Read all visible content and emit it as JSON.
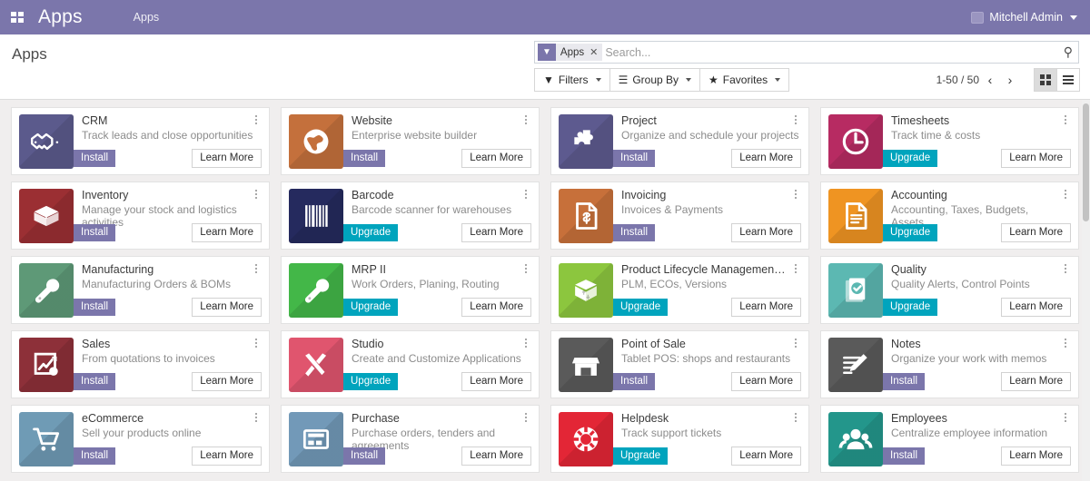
{
  "navbar": {
    "apps_grid_icon": "grid-icon",
    "brand": "Apps",
    "menu_item": "Apps",
    "user_name": "Mitchell Admin",
    "avatar_icon": "avatar-icon",
    "caret_icon": "chevron-down-icon",
    "bg_color": "#7b76ab"
  },
  "control_panel": {
    "title": "Apps",
    "search": {
      "facet_label": "Apps",
      "facet_icon": "filter-icon",
      "facet_remove_icon": "close-icon",
      "placeholder": "Search...",
      "value": "",
      "search_icon": "search-icon"
    },
    "filters_label": "Filters",
    "filters_icon": "filter-icon",
    "groupby_label": "Group By",
    "groupby_icon": "list-icon",
    "favorites_label": "Favorites",
    "favorites_icon": "star-icon",
    "pager_text": "1-50 / 50",
    "pager_prev_icon": "chevron-left-icon",
    "pager_next_icon": "chevron-right-icon",
    "view_kanban_icon": "kanban-view-icon",
    "view_list_icon": "list-view-icon",
    "active_view": "kanban"
  },
  "labels": {
    "install": "Install",
    "upgrade": "Upgrade",
    "learn_more": "Learn More",
    "kebab_icon": "kebab-menu-icon"
  },
  "colors": {
    "install_button": "#7b76ab",
    "upgrade_button": "#00a4bd",
    "navbar": "#7b76ab"
  },
  "apps": [
    {
      "name": "CRM",
      "desc": "Track leads and close opportunities",
      "action": "Install",
      "icon": "handshake-icon",
      "color": "#5b5a8c"
    },
    {
      "name": "Website",
      "desc": "Enterprise website builder",
      "action": "Install",
      "icon": "globe-icon",
      "color": "#c4703c"
    },
    {
      "name": "Project",
      "desc": "Organize and schedule your projects",
      "action": "Install",
      "icon": "puzzle-icon",
      "color": "#5d5a8f"
    },
    {
      "name": "Timesheets",
      "desc": "Track time & costs",
      "action": "Upgrade",
      "icon": "clock-icon",
      "color": "#b72b62"
    },
    {
      "name": "Inventory",
      "desc": "Manage your stock and logistics activities",
      "action": "Install",
      "icon": "box-icon",
      "color": "#9b2f33"
    },
    {
      "name": "Barcode",
      "desc": "Barcode scanner for warehouses",
      "action": "Upgrade",
      "icon": "barcode-icon",
      "color": "#252a5e"
    },
    {
      "name": "Invoicing",
      "desc": "Invoices & Payments",
      "action": "Install",
      "icon": "invoice-icon",
      "color": "#c7703a"
    },
    {
      "name": "Accounting",
      "desc": "Accounting, Taxes, Budgets, Assets...",
      "action": "Upgrade",
      "icon": "document-icon",
      "color": "#ef9422"
    },
    {
      "name": "Manufacturing",
      "desc": "Manufacturing Orders & BOMs",
      "action": "Install",
      "icon": "wrench-icon",
      "color": "#5e9977"
    },
    {
      "name": "MRP II",
      "desc": "Work Orders, Planing, Routing",
      "action": "Upgrade",
      "icon": "wrench-icon",
      "color": "#43b748"
    },
    {
      "name": "Product Lifecycle Management (...",
      "desc": "PLM, ECOs, Versions",
      "action": "Upgrade",
      "icon": "box-arrows-icon",
      "color": "#8cc63e"
    },
    {
      "name": "Quality",
      "desc": "Quality Alerts, Control Points",
      "action": "Upgrade",
      "icon": "clipboard-check-icon",
      "color": "#5cb8b2"
    },
    {
      "name": "Sales",
      "desc": "From quotations to invoices",
      "action": "Install",
      "icon": "chart-gear-icon",
      "color": "#8d3039"
    },
    {
      "name": "Studio",
      "desc": "Create and Customize Applications",
      "action": "Upgrade",
      "icon": "tools-icon",
      "color": "#e0556e"
    },
    {
      "name": "Point of Sale",
      "desc": "Tablet POS: shops and restaurants",
      "action": "Install",
      "icon": "shop-icon",
      "color": "#5a5a5a"
    },
    {
      "name": "Notes",
      "desc": "Organize your work with memos",
      "action": "Install",
      "icon": "note-pencil-icon",
      "color": "#5a5a5a"
    },
    {
      "name": "eCommerce",
      "desc": "Sell your products online",
      "action": "Install",
      "icon": "cart-icon",
      "color": "#6f9bb5"
    },
    {
      "name": "Purchase",
      "desc": "Purchase orders, tenders and agreements",
      "action": "Install",
      "icon": "card-icon",
      "color": "#7299b8"
    },
    {
      "name": "Helpdesk",
      "desc": "Track support tickets",
      "action": "Upgrade",
      "icon": "lifebuoy-icon",
      "color": "#e32636"
    },
    {
      "name": "Employees",
      "desc": "Centralize employee information",
      "action": "Install",
      "icon": "people-icon",
      "color": "#23968b"
    }
  ]
}
